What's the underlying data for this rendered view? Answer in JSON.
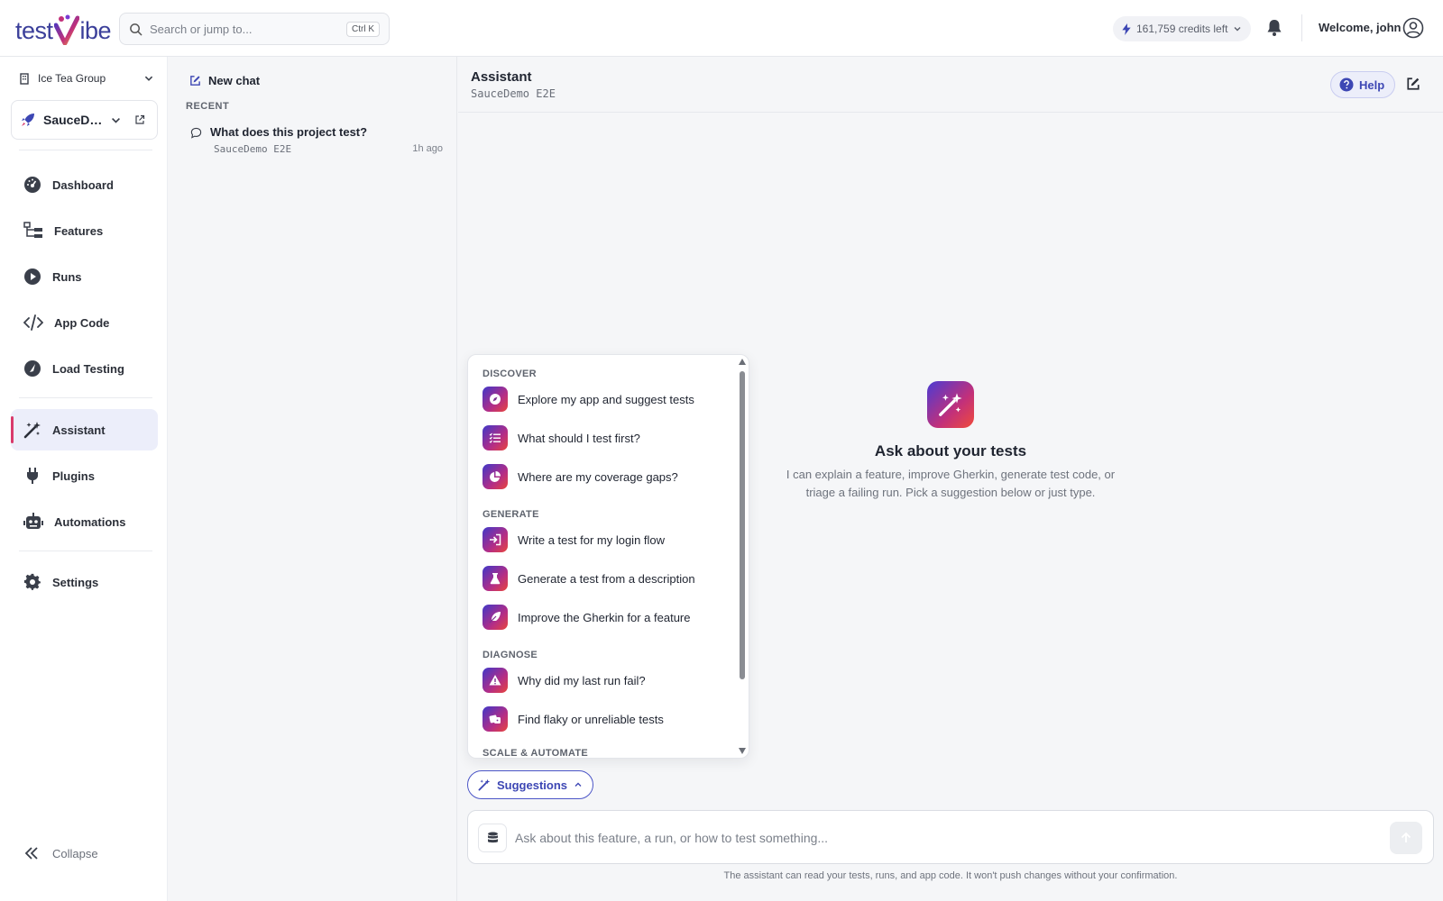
{
  "brand": {
    "logo_left": "test",
    "logo_right": "ibe",
    "accent": "#3d47b4",
    "gradient": [
      "#3f38c9",
      "#b42d86",
      "#e8463c"
    ]
  },
  "search": {
    "placeholder": "Search or jump to...",
    "shortcut": "Ctrl K"
  },
  "header": {
    "credits": "161,759 credits left",
    "welcome": "Welcome, john"
  },
  "sidebar": {
    "org": "Ice Tea Group",
    "project": "SauceDemo E2E",
    "items": [
      {
        "label": "Dashboard",
        "icon": "gauge-icon"
      },
      {
        "label": "Features",
        "icon": "hierarchy-icon"
      },
      {
        "label": "Runs",
        "icon": "play-circle-icon"
      },
      {
        "label": "App Code",
        "icon": "code-icon"
      },
      {
        "label": "Load Testing",
        "icon": "gauge-fast-icon"
      },
      {
        "label": "Assistant",
        "icon": "magic-wand-icon",
        "active": true
      },
      {
        "label": "Plugins",
        "icon": "plug-icon"
      },
      {
        "label": "Automations",
        "icon": "robot-icon"
      },
      {
        "label": "Settings",
        "icon": "gear-icon"
      }
    ],
    "collapse": "Collapse"
  },
  "history": {
    "new_chat": "New chat",
    "recent_label": "RECENT",
    "items": [
      {
        "title": "What does this project test?",
        "project": "SauceDemo E2E",
        "time": "1h ago"
      }
    ]
  },
  "main": {
    "title": "Assistant",
    "subtitle": "SauceDemo E2E",
    "help": "Help",
    "empty_title": "Ask about your tests",
    "empty_desc": "I can explain a feature, improve Gherkin, generate test code, or triage a failing run. Pick a suggestion below or just type."
  },
  "suggestions": {
    "button": "Suggestions",
    "groups": [
      {
        "label": "DISCOVER",
        "items": [
          {
            "label": "Explore my app and suggest tests",
            "icon": "compass-icon"
          },
          {
            "label": "What should I test first?",
            "icon": "list-check-icon"
          },
          {
            "label": "Where are my coverage gaps?",
            "icon": "pie-chart-icon"
          }
        ]
      },
      {
        "label": "GENERATE",
        "items": [
          {
            "label": "Write a test for my login flow",
            "icon": "login-icon"
          },
          {
            "label": "Generate a test from a description",
            "icon": "flask-icon"
          },
          {
            "label": "Improve the Gherkin for a feature",
            "icon": "feather-icon"
          }
        ]
      },
      {
        "label": "DIAGNOSE",
        "items": [
          {
            "label": "Why did my last run fail?",
            "icon": "warning-icon"
          },
          {
            "label": "Find flaky or unreliable tests",
            "icon": "dice-icon"
          }
        ]
      },
      {
        "label": "SCALE & AUTOMATE",
        "items": []
      }
    ]
  },
  "composer": {
    "placeholder": "Ask about this feature, a run, or how to test something...",
    "disclaimer": "The assistant can read your tests, runs, and app code. It won't push changes without your confirmation."
  }
}
